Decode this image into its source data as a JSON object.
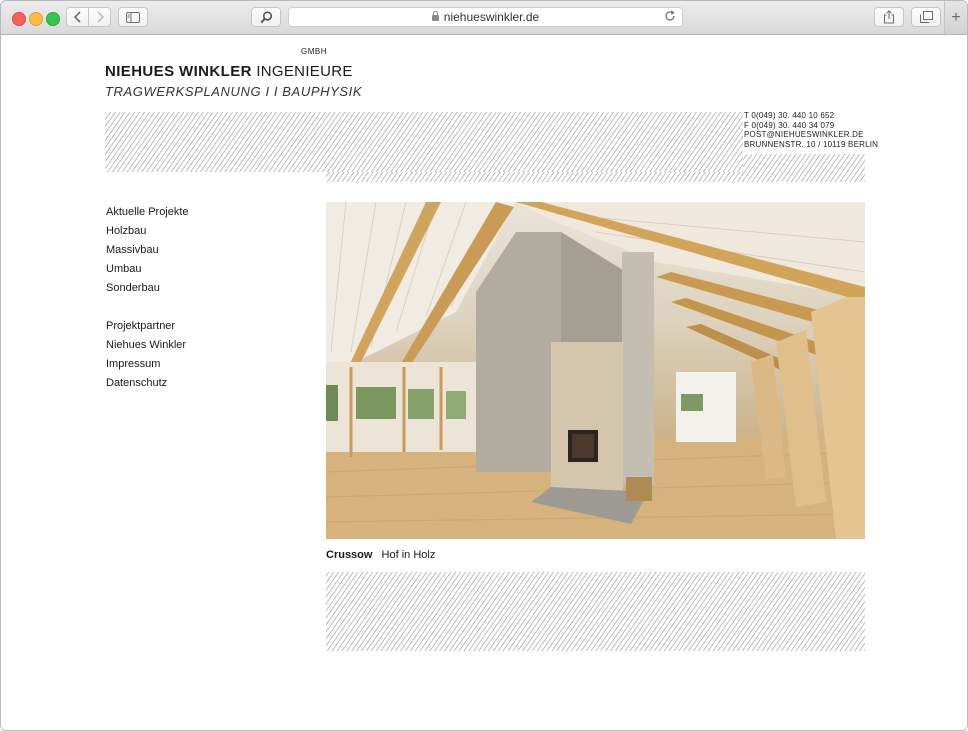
{
  "browser": {
    "url": "niehueswinkler.de"
  },
  "brand": {
    "gmbh": "GMBH",
    "name_bold": "NIEHUES WINKLER",
    "name_rest": "INGENIEURE",
    "tagline": "TRAGWERKSPLANUNG I I BAUPHYSIK"
  },
  "contact": {
    "phone": "T 0(049) 30. 440 10 652",
    "fax": "F 0(049) 30. 440 34 079",
    "email": "POST@NIEHUESWINKLER.DE",
    "address": "BRUNNENSTR. 10 / 10119 BERLIN"
  },
  "nav": {
    "primary": [
      "Aktuelle Projekte",
      "Holzbau",
      "Massivbau",
      "Umbau",
      "Sonderbau"
    ],
    "secondary": [
      "Projektpartner",
      "Niehues Winkler",
      "Impressum",
      "Datenschutz"
    ]
  },
  "project": {
    "title": "Crussow",
    "subtitle": "Hof in Holz"
  },
  "colors": {
    "hatch": "#bdbdbd",
    "wood": "#d8b57a",
    "concrete": "#b7b1a4"
  }
}
